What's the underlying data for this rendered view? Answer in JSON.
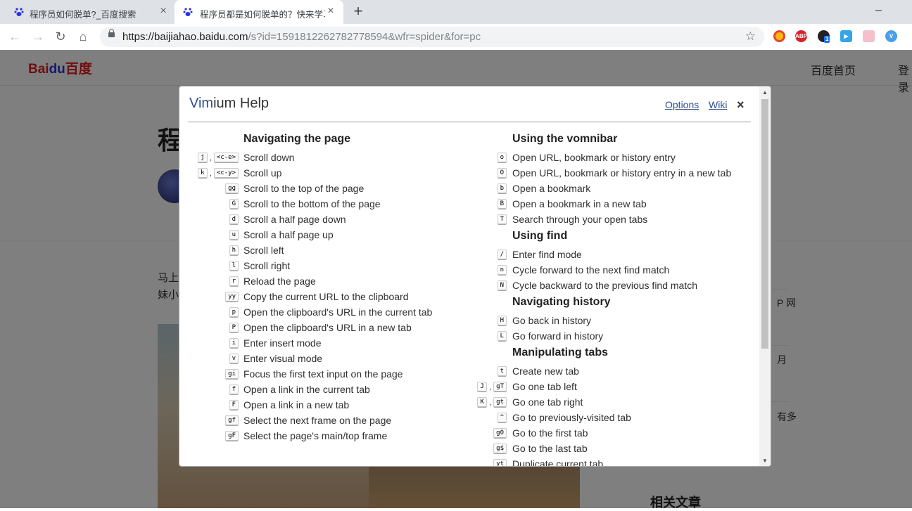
{
  "browser": {
    "tabs": [
      {
        "title": "程序员如何脱单?_百度搜索",
        "active": false
      },
      {
        "title": "程序员都是如何脱单的？快来学习",
        "active": true
      }
    ],
    "new_tab_icon": "plus-icon",
    "url_host": "https://baijiahao.baidu.com",
    "url_path": "/s?id=1591812262782778594&wfr=spider&for=pc",
    "extension_badge": "1"
  },
  "baidu": {
    "logo_left": "Bai",
    "logo_mid": "du",
    "logo_right": "百度",
    "home_link": "百度首页",
    "login_link": "登录",
    "title_fragment": "程",
    "body_line1": "马上",
    "body_line2": "妹小",
    "side_1": "P 网",
    "side_2": "月",
    "side_3": "有多",
    "related_title": "相关文章"
  },
  "vimium": {
    "title_prefix": "Vim",
    "title_suffix": "ium Help",
    "options_link": "Options",
    "wiki_link": "Wiki",
    "close_label": "×",
    "left_column": [
      {
        "heading": "Navigating the page",
        "rows": [
          {
            "keys": [
              "j",
              "<c-e>"
            ],
            "desc": "Scroll down"
          },
          {
            "keys": [
              "k",
              "<c-y>"
            ],
            "desc": "Scroll up"
          },
          {
            "keys": [
              "gg"
            ],
            "desc": "Scroll to the top of the page"
          },
          {
            "keys": [
              "G"
            ],
            "desc": "Scroll to the bottom of the page"
          },
          {
            "keys": [
              "d"
            ],
            "desc": "Scroll a half page down"
          },
          {
            "keys": [
              "u"
            ],
            "desc": "Scroll a half page up"
          },
          {
            "keys": [
              "h"
            ],
            "desc": "Scroll left"
          },
          {
            "keys": [
              "l"
            ],
            "desc": "Scroll right"
          },
          {
            "keys": [
              "r"
            ],
            "desc": "Reload the page"
          },
          {
            "keys": [
              "yy"
            ],
            "desc": "Copy the current URL to the clipboard"
          },
          {
            "keys": [
              "p"
            ],
            "desc": "Open the clipboard's URL in the current tab"
          },
          {
            "keys": [
              "P"
            ],
            "desc": "Open the clipboard's URL in a new tab"
          },
          {
            "keys": [
              "i"
            ],
            "desc": "Enter insert mode"
          },
          {
            "keys": [
              "v"
            ],
            "desc": "Enter visual mode"
          },
          {
            "keys": [
              "gi"
            ],
            "desc": "Focus the first text input on the page"
          },
          {
            "keys": [
              "f"
            ],
            "desc": "Open a link in the current tab"
          },
          {
            "keys": [
              "F"
            ],
            "desc": "Open a link in a new tab"
          },
          {
            "keys": [
              "gf"
            ],
            "desc": "Select the next frame on the page"
          },
          {
            "keys": [
              "gF"
            ],
            "desc": "Select the page's main/top frame"
          }
        ]
      }
    ],
    "right_column": [
      {
        "heading": "Using the vomnibar",
        "rows": [
          {
            "keys": [
              "o"
            ],
            "desc": "Open URL, bookmark or history entry"
          },
          {
            "keys": [
              "O"
            ],
            "desc": "Open URL, bookmark or history entry in a new tab"
          },
          {
            "keys": [
              "b"
            ],
            "desc": "Open a bookmark"
          },
          {
            "keys": [
              "B"
            ],
            "desc": "Open a bookmark in a new tab"
          },
          {
            "keys": [
              "T"
            ],
            "desc": "Search through your open tabs"
          }
        ]
      },
      {
        "heading": "Using find",
        "rows": [
          {
            "keys": [
              "/"
            ],
            "desc": "Enter find mode"
          },
          {
            "keys": [
              "n"
            ],
            "desc": "Cycle forward to the next find match"
          },
          {
            "keys": [
              "N"
            ],
            "desc": "Cycle backward to the previous find match"
          }
        ]
      },
      {
        "heading": "Navigating history",
        "rows": [
          {
            "keys": [
              "H"
            ],
            "desc": "Go back in history"
          },
          {
            "keys": [
              "L"
            ],
            "desc": "Go forward in history"
          }
        ]
      },
      {
        "heading": "Manipulating tabs",
        "rows": [
          {
            "keys": [
              "t"
            ],
            "desc": "Create new tab"
          },
          {
            "keys": [
              "J",
              "gT"
            ],
            "desc": "Go one tab left"
          },
          {
            "keys": [
              "K",
              "gt"
            ],
            "desc": "Go one tab right"
          },
          {
            "keys": [
              "^"
            ],
            "desc": "Go to previously-visited tab"
          },
          {
            "keys": [
              "g0"
            ],
            "desc": "Go to the first tab"
          },
          {
            "keys": [
              "g$"
            ],
            "desc": "Go to the last tab"
          },
          {
            "keys": [
              "yt"
            ],
            "desc": "Duplicate current tab"
          }
        ]
      }
    ]
  }
}
